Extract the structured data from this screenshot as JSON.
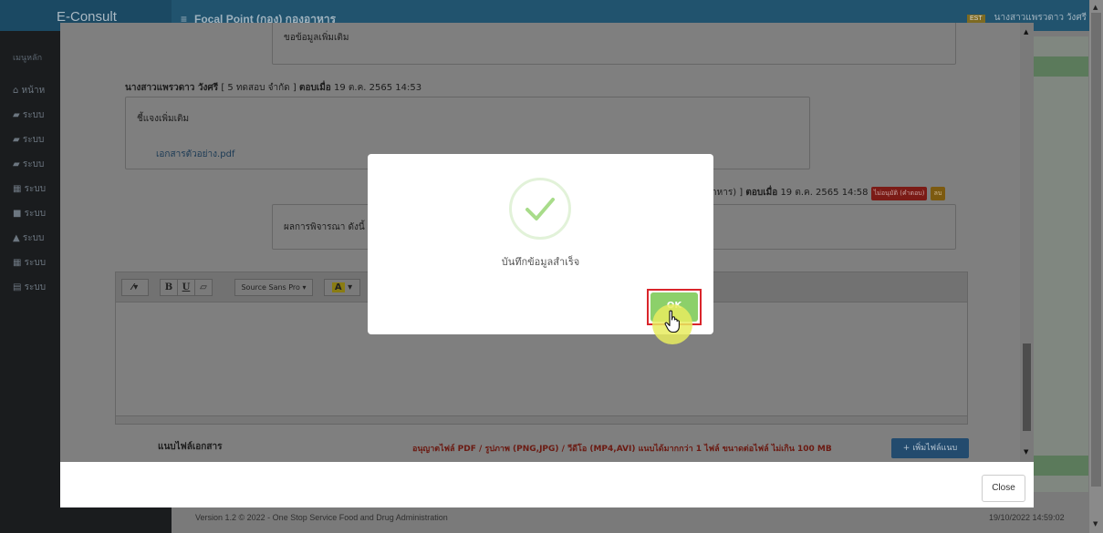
{
  "app": {
    "brand": "E-Consult",
    "page_title": "Focal Point (กอง) กองอาหาร",
    "user_badge": "EST",
    "user_name": "นางสาวแพรวดาว วังศรี"
  },
  "sidebar": {
    "menu_header": "เมนูหลัก",
    "items": [
      {
        "label": "หน้าห",
        "icon": "home-icon"
      },
      {
        "label": "ระบบ",
        "icon": "book-icon"
      },
      {
        "label": "ระบบ",
        "icon": "book-icon"
      },
      {
        "label": "ระบบ",
        "icon": "book-icon"
      },
      {
        "label": "ระบบ",
        "icon": "calendar-icon"
      },
      {
        "label": "ระบบ",
        "icon": "video-icon"
      },
      {
        "label": "ระบบ",
        "icon": "graduation-cap-icon"
      },
      {
        "label": "ระบบ",
        "icon": "calendar-icon"
      },
      {
        "label": "ระบบ",
        "icon": "document-icon"
      }
    ]
  },
  "thread": {
    "first_message_text": "ขอข้อมูลเพิ่มเติม",
    "reply1": {
      "author": "นางสาวแพรวดาว วังศรี",
      "org": "[ 5 ทดสอบ จำกัด ]",
      "replied_label": "ตอบเมื่อ",
      "timestamp": "19 ต.ค. 2565 14:53",
      "body": "ชี้แจงเพิ่มเติม",
      "attachment": "เอกสารตัวอย่าง.pdf"
    },
    "reply2": {
      "header_tail": "าหาร) ]",
      "replied_label": "ตอบเมื่อ",
      "timestamp": "19 ต.ค. 2565 14:58",
      "status_tag": "ไม่อนุมัติ (คำตอบ)",
      "delete_label": "ลบ",
      "body": "ผลการพิจารณา ดังนี้"
    }
  },
  "editor": {
    "font_name": "Source Sans Pro"
  },
  "attach": {
    "label": "แนบไฟล์เอกสาร",
    "note": "อนุญาตไฟล์ PDF / รูปภาพ (PNG,JPG) / วีดีโอ (MP4,AVI) แนบได้มากกว่า 1 ไฟล์ ขนาดต่อไฟล์ ไม่เกิน 100 MB",
    "add_button": "เพิ่มไฟล์แนบ"
  },
  "modal": {
    "close_label": "Close"
  },
  "dialog": {
    "message": "บันทึกข้อมูลสำเร็จ",
    "ok_label": "OK"
  },
  "footer": {
    "version": "Version 1.2 © 2022 - One Stop Service Food and Drug Administration",
    "datetime": "19/10/2022 14:59:02"
  },
  "colors": {
    "success_green": "#8cd06a",
    "highlight_red": "#d9252b",
    "primary_blue": "#1f6fb3"
  }
}
